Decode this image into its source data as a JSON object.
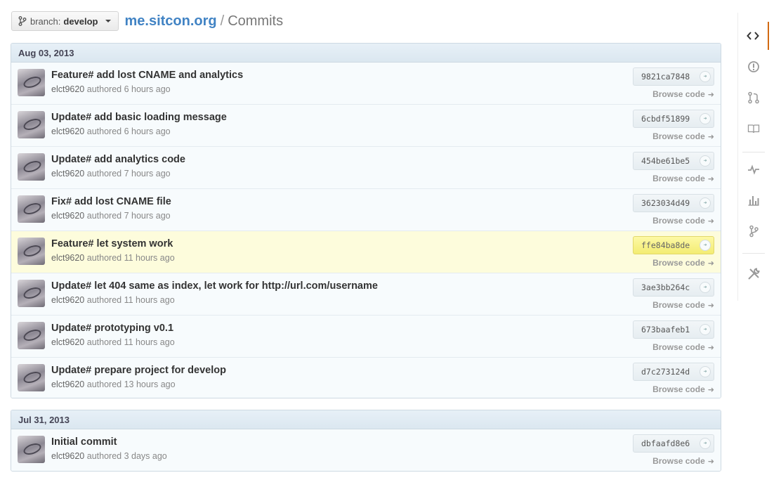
{
  "header": {
    "branch_prefix": "branch:",
    "branch_name": "develop",
    "repo": "me.sitcon.org",
    "separator": "/",
    "page": "Commits"
  },
  "groups": [
    {
      "date": "Aug 03, 2013",
      "commits": [
        {
          "message": "Feature# add lost CNAME and analytics",
          "author": "elct9620",
          "authored": "authored",
          "time": "6 hours ago",
          "sha": "9821ca7848",
          "browse": "Browse code"
        },
        {
          "message": "Update# add basic loading message",
          "author": "elct9620",
          "authored": "authored",
          "time": "6 hours ago",
          "sha": "6cbdf51899",
          "browse": "Browse code"
        },
        {
          "message": "Update# add analytics code",
          "author": "elct9620",
          "authored": "authored",
          "time": "7 hours ago",
          "sha": "454be61be5",
          "browse": "Browse code"
        },
        {
          "message": "Fix# add lost CNAME file",
          "author": "elct9620",
          "authored": "authored",
          "time": "7 hours ago",
          "sha": "3623034d49",
          "browse": "Browse code"
        },
        {
          "message": "Feature# let system work",
          "author": "elct9620",
          "authored": "authored",
          "time": "11 hours ago",
          "sha": "ffe84ba8de",
          "browse": "Browse code",
          "highlighted": true
        },
        {
          "message": "Update# let 404 same as index, let work for http://url.com/username",
          "author": "elct9620",
          "authored": "authored",
          "time": "11 hours ago",
          "sha": "3ae3bb264c",
          "browse": "Browse code"
        },
        {
          "message": "Update# prototyping v0.1",
          "author": "elct9620",
          "authored": "authored",
          "time": "11 hours ago",
          "sha": "673baafeb1",
          "browse": "Browse code"
        },
        {
          "message": "Update# prepare project for develop",
          "author": "elct9620",
          "authored": "authored",
          "time": "13 hours ago",
          "sha": "d7c273124d",
          "browse": "Browse code"
        }
      ]
    },
    {
      "date": "Jul 31, 2013",
      "commits": [
        {
          "message": "Initial commit",
          "author": "elct9620",
          "authored": "authored",
          "time": "3 days ago",
          "sha": "dbfaafd8e6",
          "browse": "Browse code"
        }
      ]
    }
  ],
  "sidebar": {
    "items": [
      {
        "icon": "code-icon",
        "active": true
      },
      {
        "icon": "issues-icon"
      },
      {
        "icon": "pull-request-icon"
      },
      {
        "icon": "wiki-icon"
      },
      {
        "icon": "pulse-icon"
      },
      {
        "icon": "graphs-icon"
      },
      {
        "icon": "network-icon"
      },
      {
        "icon": "settings-icon"
      }
    ]
  },
  "colors": {
    "link": "#4183c4",
    "active_nav": "#d26911",
    "highlight_row": "#fdfcdc",
    "group_header": "#e3edf5"
  }
}
